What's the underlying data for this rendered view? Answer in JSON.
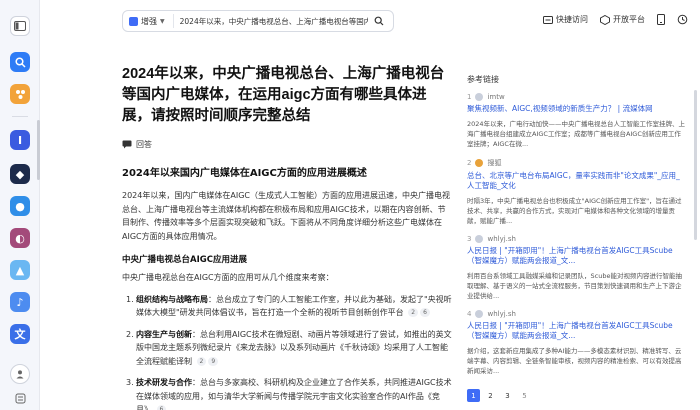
{
  "header": {
    "search_mode": "增强",
    "search_query": "2024年以来，中央广播电视总台、上海广播电视台等国内广电媒",
    "actions": [
      {
        "label": "快捷访问",
        "icon": "quick-access-icon"
      },
      {
        "label": "开放平台",
        "icon": "open-platform-icon"
      }
    ]
  },
  "main": {
    "title": "2024年以来，中央广播电视总台、上海广播电视台等国内广电媒体，在运用aigc方面有哪些具体进展，请按照时间顺序完整总结",
    "answer_label": "回答",
    "section_title": "2024年以来国内广电媒体在AIGC方面的应用进展概述",
    "intro": "2024年以来，国内广电媒体在AIGC（生成式人工智能）方面的应用进展迅速，中央广播电视总台、上海广播电视台等主流媒体机构都在积极布局和应用AIGC技术，以期在内容创新、节目制作、传播效率等多个层面实现突破和飞跃。下面将从不同角度详细分析这些广电媒体在AIGC方面的具体应用情况。",
    "subsection_title": "中央广播电视总台AIGC应用进展",
    "sub_intro": "中央广播电视总台在AIGC方面的应用可从几个维度来考察：",
    "items": [
      {
        "num": "1.",
        "bold": "组织结构与战略布局",
        "text": "：总台成立了专门的人工智能工作室，并以此为基础，发起了\"央视听媒体大模型\"研发共同体倡议书，旨在打造一个全新的视听节目创新创作平台",
        "cites": [
          "2",
          "6"
        ]
      },
      {
        "num": "2.",
        "bold": "内容生产与创新",
        "text": "：总台利用AIGC技术在微短剧、动画片等领域进行了尝试，如推出的英文版中国龙主题系列微纪录片《来龙去脉》以及系列动画片《千秋诗颂》均采用了人工智能全流程赋能译制",
        "cites": [
          "2",
          "9"
        ]
      },
      {
        "num": "3.",
        "bold": "技术研发与合作",
        "text": "：总台与多家高校、科研机构及企业建立了合作关系，共同推进AIGC技术在媒体领域的应用，如与清华大学新闻与传播学院元宇宙文化实验室合作的AI作品《竞月》",
        "cites": [
          "6"
        ]
      }
    ]
  },
  "references": {
    "heading": "参考链接",
    "pagination": [
      "1",
      "2",
      "3",
      "5"
    ],
    "active_page": "1",
    "items": [
      {
        "num": "1",
        "source": "imtw",
        "title": "聚焦视频新、AIGC,视频领域的新质生产力？ | 流媒体网",
        "snippet": "2024年以来，广电行动加快——中央广播电视总台人工智能工作室挂牌、上海广播电视台组建成立AIGC工作室；成都等广播电视台AIGC创新应用工作室挂牌；AIGC在微..."
      },
      {
        "num": "2",
        "source": "搜狐",
        "title": "总台、北京等广电台布局AIGC，量率实践而非\"论文成果\"_应用_人工智能_文化",
        "snippet": "时隔3年，中央广播电视总台也积极成立\"AIGC创新应用工作室\"，旨在通过技术、共享，共赢的合作方式，实现对广电媒体和各种文化领域的增量贡献，赋能广播..."
      },
      {
        "num": "3",
        "source": "whlyj.sh",
        "title": "人民日报 | \"开箱即用\"！上海广播电视台首发AIGC工具Scube（智媒魔方）赋能两会报道_文...",
        "snippet": "利用百台系领域工具融媒采编和记录团队，Scube能对视频内容进行智能抽取理解、基于语义的一站式全流程服务，节目策划快速调用和生产上下游企业提供给..."
      },
      {
        "num": "4",
        "source": "whlyj.sh",
        "title": "人民日报 | \"开箱即用\"！上海广播电视台首发AIGC工具Scube（智媒魔方）赋能两会报道_文...",
        "snippet": "据介绍，这套新应用集成了多种AI能力——多模态素材识别、精准转写、云端字幕、内容剪辑、全链条智能审核，视频内容的精准检索、可以有效提高新闻采访..."
      }
    ]
  }
}
